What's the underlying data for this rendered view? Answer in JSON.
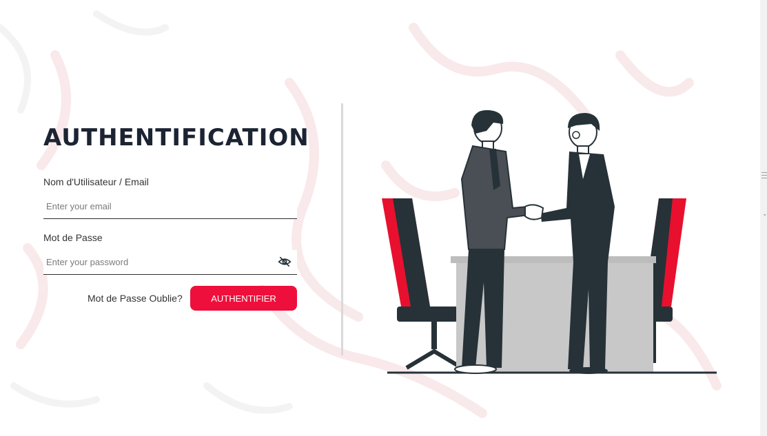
{
  "page": {
    "title": "AUTHENTIFICATION"
  },
  "form": {
    "username_label": "Nom d'Utilisateur / Email",
    "username_placeholder": "Enter your email",
    "password_label": "Mot de Passe",
    "password_placeholder": "Enter your password",
    "forgot_link": "Mot de Passe Oublie?",
    "submit_label": "AUTHENTIFIER"
  },
  "icons": {
    "password_toggle": "eye-off-icon"
  },
  "colors": {
    "accent": "#ef0f3c",
    "title": "#1c2433",
    "divider": "#d9d9d9",
    "illustration_dark": "#263238",
    "illustration_red": "#e8102e",
    "desk": "#c8c8c8"
  }
}
